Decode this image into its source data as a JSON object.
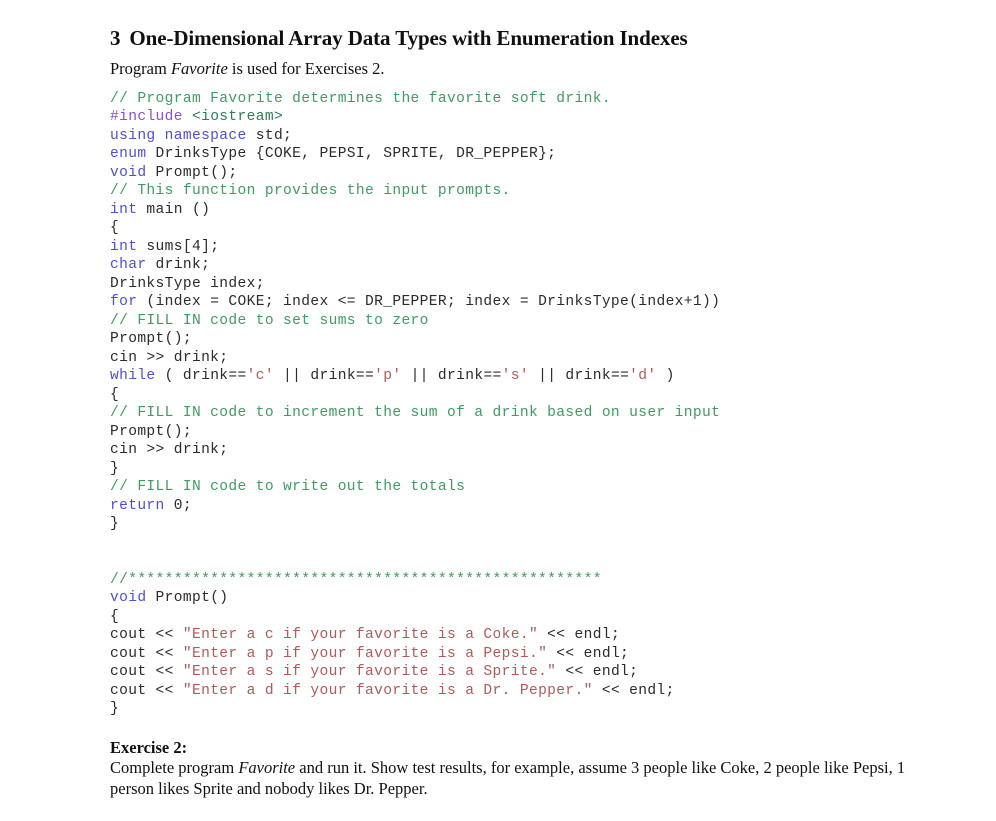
{
  "section": {
    "number": "3",
    "title": "One-Dimensional Array Data Types with Enumeration Indexes",
    "intro_before": "Program ",
    "intro_italic": "Favorite",
    "intro_after": " is used for Exercises 2."
  },
  "colors": {
    "comment": "#3f9c62",
    "keyword": "#4f4fd4",
    "preprocessor": "#8a4fd4",
    "header_name": "#2e7d57",
    "string": "#b05a5a",
    "plain": "#2b2b2b",
    "text": "#111111",
    "background": "#ffffff"
  },
  "code": {
    "language": "cpp",
    "lines": [
      {
        "segments": [
          {
            "t": "// Program Favorite determines the favorite soft drink.",
            "c": "cm"
          }
        ]
      },
      {
        "segments": [
          {
            "t": "#include",
            "c": "pp"
          },
          {
            "t": " ",
            "c": "pl"
          },
          {
            "t": "<iostream>",
            "c": "hdr"
          }
        ]
      },
      {
        "segments": [
          {
            "t": "using namespace",
            "c": "kw"
          },
          {
            "t": " std;",
            "c": "pl"
          }
        ]
      },
      {
        "segments": [
          {
            "t": "enum",
            "c": "kw"
          },
          {
            "t": " DrinksType {COKE, PEPSI, SPRITE, DR_PEPPER};",
            "c": "pl"
          }
        ]
      },
      {
        "segments": [
          {
            "t": "void",
            "c": "kw"
          },
          {
            "t": " Prompt();",
            "c": "pl"
          }
        ]
      },
      {
        "segments": [
          {
            "t": "// This function provides the input prompts.",
            "c": "cm"
          }
        ]
      },
      {
        "segments": [
          {
            "t": "int",
            "c": "kw"
          },
          {
            "t": " main ()",
            "c": "pl"
          }
        ]
      },
      {
        "segments": [
          {
            "t": "{",
            "c": "pl"
          }
        ]
      },
      {
        "segments": [
          {
            "t": "int",
            "c": "kw"
          },
          {
            "t": " sums[4];",
            "c": "pl"
          }
        ]
      },
      {
        "segments": [
          {
            "t": "char",
            "c": "kw"
          },
          {
            "t": " drink;",
            "c": "pl"
          }
        ]
      },
      {
        "segments": [
          {
            "t": "DrinksType index;",
            "c": "pl"
          }
        ]
      },
      {
        "segments": [
          {
            "t": "for",
            "c": "kw"
          },
          {
            "t": " (index = COKE; index <= DR_PEPPER; index = DrinksType(index+1))",
            "c": "pl"
          }
        ]
      },
      {
        "segments": [
          {
            "t": "// FILL IN code to set sums to zero",
            "c": "cm"
          }
        ]
      },
      {
        "segments": [
          {
            "t": "Prompt();",
            "c": "pl"
          }
        ]
      },
      {
        "segments": [
          {
            "t": "cin >> drink;",
            "c": "pl"
          }
        ]
      },
      {
        "segments": [
          {
            "t": "while",
            "c": "kw"
          },
          {
            "t": " ( drink==",
            "c": "pl"
          },
          {
            "t": "'c'",
            "c": "chr"
          },
          {
            "t": " || drink==",
            "c": "pl"
          },
          {
            "t": "'p'",
            "c": "chr"
          },
          {
            "t": " || drink==",
            "c": "pl"
          },
          {
            "t": "'s'",
            "c": "chr"
          },
          {
            "t": " || drink==",
            "c": "pl"
          },
          {
            "t": "'d'",
            "c": "chr"
          },
          {
            "t": " )",
            "c": "pl"
          }
        ]
      },
      {
        "segments": [
          {
            "t": "{",
            "c": "pl"
          }
        ]
      },
      {
        "segments": [
          {
            "t": "// FILL IN code to increment the sum of a drink based on user input",
            "c": "cm"
          }
        ]
      },
      {
        "segments": [
          {
            "t": "Prompt();",
            "c": "pl"
          }
        ]
      },
      {
        "segments": [
          {
            "t": "cin >> drink;",
            "c": "pl"
          }
        ]
      },
      {
        "segments": [
          {
            "t": "}",
            "c": "pl"
          }
        ]
      },
      {
        "segments": [
          {
            "t": "// FILL IN code to write out the totals",
            "c": "cm"
          }
        ]
      },
      {
        "segments": [
          {
            "t": "return",
            "c": "kw"
          },
          {
            "t": " 0;",
            "c": "pl"
          }
        ]
      },
      {
        "segments": [
          {
            "t": "}",
            "c": "pl"
          }
        ]
      },
      {
        "segments": [
          {
            "t": "",
            "c": "pl"
          }
        ]
      },
      {
        "segments": [
          {
            "t": "",
            "c": "pl"
          }
        ]
      },
      {
        "segments": [
          {
            "t": "//****************************************************",
            "c": "cm"
          }
        ]
      },
      {
        "segments": [
          {
            "t": "void",
            "c": "kw"
          },
          {
            "t": " Prompt()",
            "c": "pl"
          }
        ]
      },
      {
        "segments": [
          {
            "t": "{",
            "c": "pl"
          }
        ]
      },
      {
        "segments": [
          {
            "t": "cout << ",
            "c": "pl"
          },
          {
            "t": "\"Enter a c if your favorite is a Coke.\"",
            "c": "str"
          },
          {
            "t": " << endl;",
            "c": "pl"
          }
        ]
      },
      {
        "segments": [
          {
            "t": "cout << ",
            "c": "pl"
          },
          {
            "t": "\"Enter a p if your favorite is a Pepsi.\"",
            "c": "str"
          },
          {
            "t": " << endl;",
            "c": "pl"
          }
        ]
      },
      {
        "segments": [
          {
            "t": "cout << ",
            "c": "pl"
          },
          {
            "t": "\"Enter a s if your favorite is a Sprite.\"",
            "c": "str"
          },
          {
            "t": " << endl;",
            "c": "pl"
          }
        ]
      },
      {
        "segments": [
          {
            "t": "cout << ",
            "c": "pl"
          },
          {
            "t": "\"Enter a d if your favorite is a Dr. Pepper.\"",
            "c": "str"
          },
          {
            "t": " << endl;",
            "c": "pl"
          }
        ]
      },
      {
        "segments": [
          {
            "t": "}",
            "c": "pl"
          }
        ]
      }
    ]
  },
  "exercise": {
    "heading": "Exercise 2:",
    "body_before": "Complete program ",
    "body_italic": "Favorite",
    "body_after": " and run it. Show test results, for example, assume 3 people like Coke, 2 people like Pepsi, 1 person likes Sprite and nobody likes Dr. Pepper."
  }
}
